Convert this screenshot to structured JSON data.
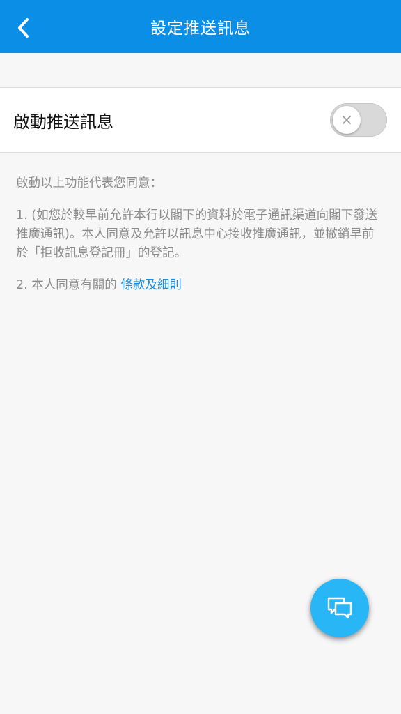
{
  "header": {
    "title": "設定推送訊息",
    "back_icon": "chevron-left-icon",
    "background_color": "#0b8ee5"
  },
  "push_setting": {
    "label": "啟動推送訊息",
    "toggle_state": "off",
    "toggle_icon": "close-icon"
  },
  "description": {
    "intro": "啟動以上功能代表您同意：",
    "item1": "1. (如您於較早前允許本行以閣下的資料於電子通訊渠道向閣下發送推廣通訊)。本人同意及允許以訊息中心接收推廣通訊，並撤銷早前於「拒收訊息登記冊」的登記。",
    "item2_prefix": "2. 本人同意有關的",
    "item2_link": "條款及細則",
    "link_color": "#1a8fe0"
  },
  "fab": {
    "icon": "chat-bubbles-icon",
    "color": "#29b6f6"
  }
}
